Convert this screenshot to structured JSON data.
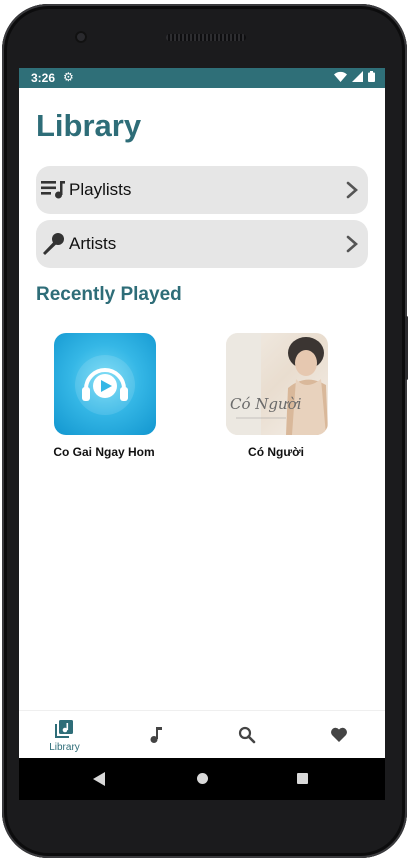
{
  "status": {
    "time": "3:26"
  },
  "header": {
    "title": "Library"
  },
  "menu": {
    "playlists_label": "Playlists",
    "artists_label": "Artists"
  },
  "recent": {
    "title": "Recently Played",
    "items": [
      {
        "title": "Co Gai Ngay Hom",
        "art": "headphones-play-artwork"
      },
      {
        "title": "Có Người",
        "art": "co-nguoi-album-cover",
        "art_text": "Có Người"
      }
    ]
  },
  "bottom_nav": {
    "items": [
      {
        "label": "Library",
        "icon": "library-icon",
        "active": true
      },
      {
        "label": "",
        "icon": "music-note-icon"
      },
      {
        "label": "",
        "icon": "search-icon"
      },
      {
        "label": "",
        "icon": "heart-icon"
      }
    ]
  },
  "colors": {
    "accent": "#2e6d78",
    "status_bar": "#2f6f78",
    "row_bg": "#e6e6e6"
  }
}
